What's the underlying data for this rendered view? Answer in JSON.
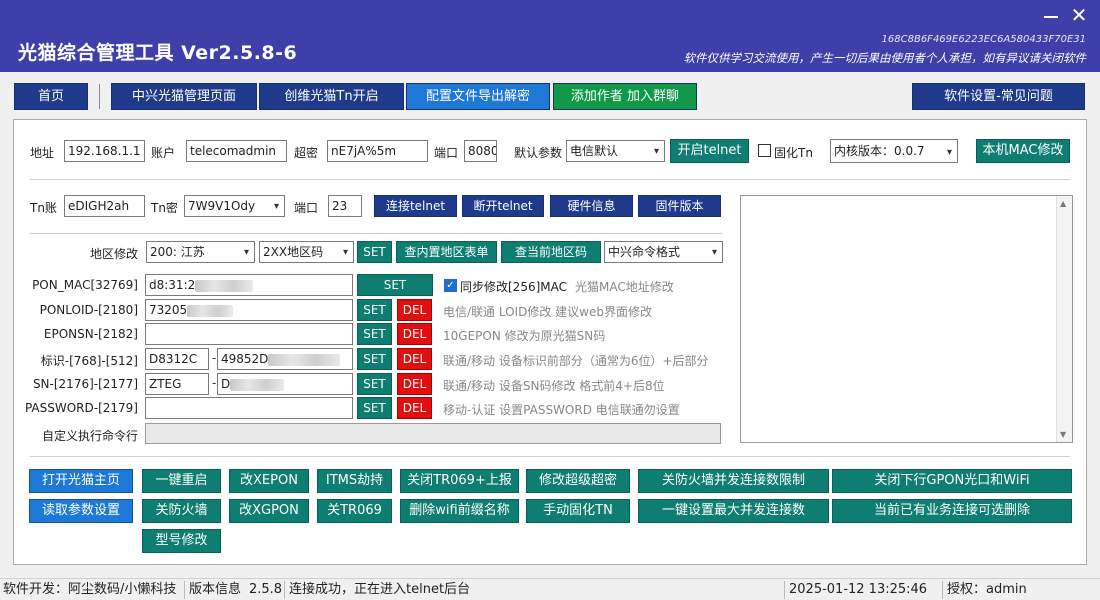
{
  "window": {
    "title": "光猫综合管理工具 Ver2.5.8-6",
    "hash": "168C8B6F469E6223EC6A580433F70E31",
    "disclaimer": "软件仅供学习交流使用，产生一切后果由使用者个人承担，如有异议请关闭软件",
    "close_glyph": "✕"
  },
  "nav": {
    "home": "首页",
    "zte": "中兴光猫管理页面",
    "chuangwei": "创维光猫Tn开启",
    "config_export": "配置文件导出解密",
    "add_author": "添加作者 加入群聊",
    "settings_faq": "软件设置-常见问题"
  },
  "conn": {
    "address_label": "地址",
    "address_value": "192.168.1.1",
    "account_label": "账户",
    "account_value": "telecomadmin",
    "password_label": "超密",
    "password_value": "nE7jA%5m",
    "port_label": "端口",
    "port_value": "8080",
    "default_label": "默认参数",
    "default_value": "电信默认",
    "open_telnet": "开启telnet",
    "solidify_label": "固化Tn",
    "kernel_value": "内核版本：0.0.7",
    "mac_modify": "本机MAC修改"
  },
  "tn": {
    "account_label": "Tn账",
    "account_value": "eDIGH2ah",
    "password_label": "Tn密",
    "password_value": "7W9V1Ody",
    "port_label": "端口",
    "port_value": "23",
    "connect": "连接telnet",
    "disconnect": "断开telnet",
    "hardware": "硬件信息",
    "firmware": "固件版本"
  },
  "region": {
    "label": "地区修改",
    "area_value": "200: 江苏",
    "code_value": "2XX地区码",
    "set": "SET",
    "query_builtin": "查内置地区表单",
    "query_current": "查当前地区码",
    "cmd_format": "中兴命令格式"
  },
  "params": [
    {
      "label": "PON_MAC[32769]",
      "value": "d8:31:2",
      "set": "SET",
      "hint": "光猫MAC地址修改"
    },
    {
      "label": "PONLOID-[2180]",
      "value": "73205",
      "set": "SET",
      "del": "DEL",
      "hint": "电信/联通  LOID修改 建议web界面修改"
    },
    {
      "label": "EPONSN-[2182]",
      "value": "",
      "set": "SET",
      "del": "DEL",
      "hint": "10GEPON  修改为原光猫SN码"
    },
    {
      "label": "标识-[768]-[512]",
      "value1": "D8312C",
      "value2": "49852D",
      "set": "SET",
      "del": "DEL",
      "hint": "联通/移动  设备标识前部分（通常为6位）+后部分"
    },
    {
      "label": "SN-[2176]-[2177]",
      "value1": "ZTEG",
      "value2": "D",
      "set": "SET",
      "del": "DEL",
      "hint": "联通/移动  设备SN码修改  格式前4+后8位"
    },
    {
      "label": "PASSWORD-[2179]",
      "value": "",
      "set": "SET",
      "del": "DEL",
      "hint": "移动-认证  设置PASSWORD 电信联通勿设置"
    }
  ],
  "sync_mac_label": "同步修改[256]MAC",
  "dash": "-",
  "custom_cmd_label": "自定义执行命令行",
  "actions": {
    "open_home": "打开光猫主页",
    "read_params": "读取参数设置",
    "reboot": "一键重启",
    "fw_off": "关防火墙",
    "model": "型号修改",
    "xepon": "改XEPON",
    "xgpon": "改XGPON",
    "itms": "ITMS劫持",
    "tr069_off": "关TR069",
    "tr069_report": "关闭TR069+上报",
    "wifi_prefix": "删除wifi前缀名称",
    "super_pwd": "修改超级超密",
    "manual_tn": "手动固化TN",
    "fw_conn_limit": "关防火墙并发连接数限制",
    "max_conn": "一键设置最大并发连接数",
    "gpon_wifi_off": "关闭下行GPON光口和WiFi",
    "business_delete": "当前已有业务连接可选删除"
  },
  "status": {
    "dev": "软件开发：阿尘数码/小懒科技",
    "version_label": "版本信息",
    "version": "2.5.8",
    "message": "连接成功，正在进入telnet后台",
    "datetime": "2025-01-12 13:25:46",
    "auth": "授权：admin"
  },
  "colors": {
    "title_bar": "#3e3fa8",
    "dark_blue": "#1f3a8a",
    "blue": "#1e78d6",
    "green": "#109948",
    "teal": "#0f7e72",
    "red": "#e01010"
  }
}
